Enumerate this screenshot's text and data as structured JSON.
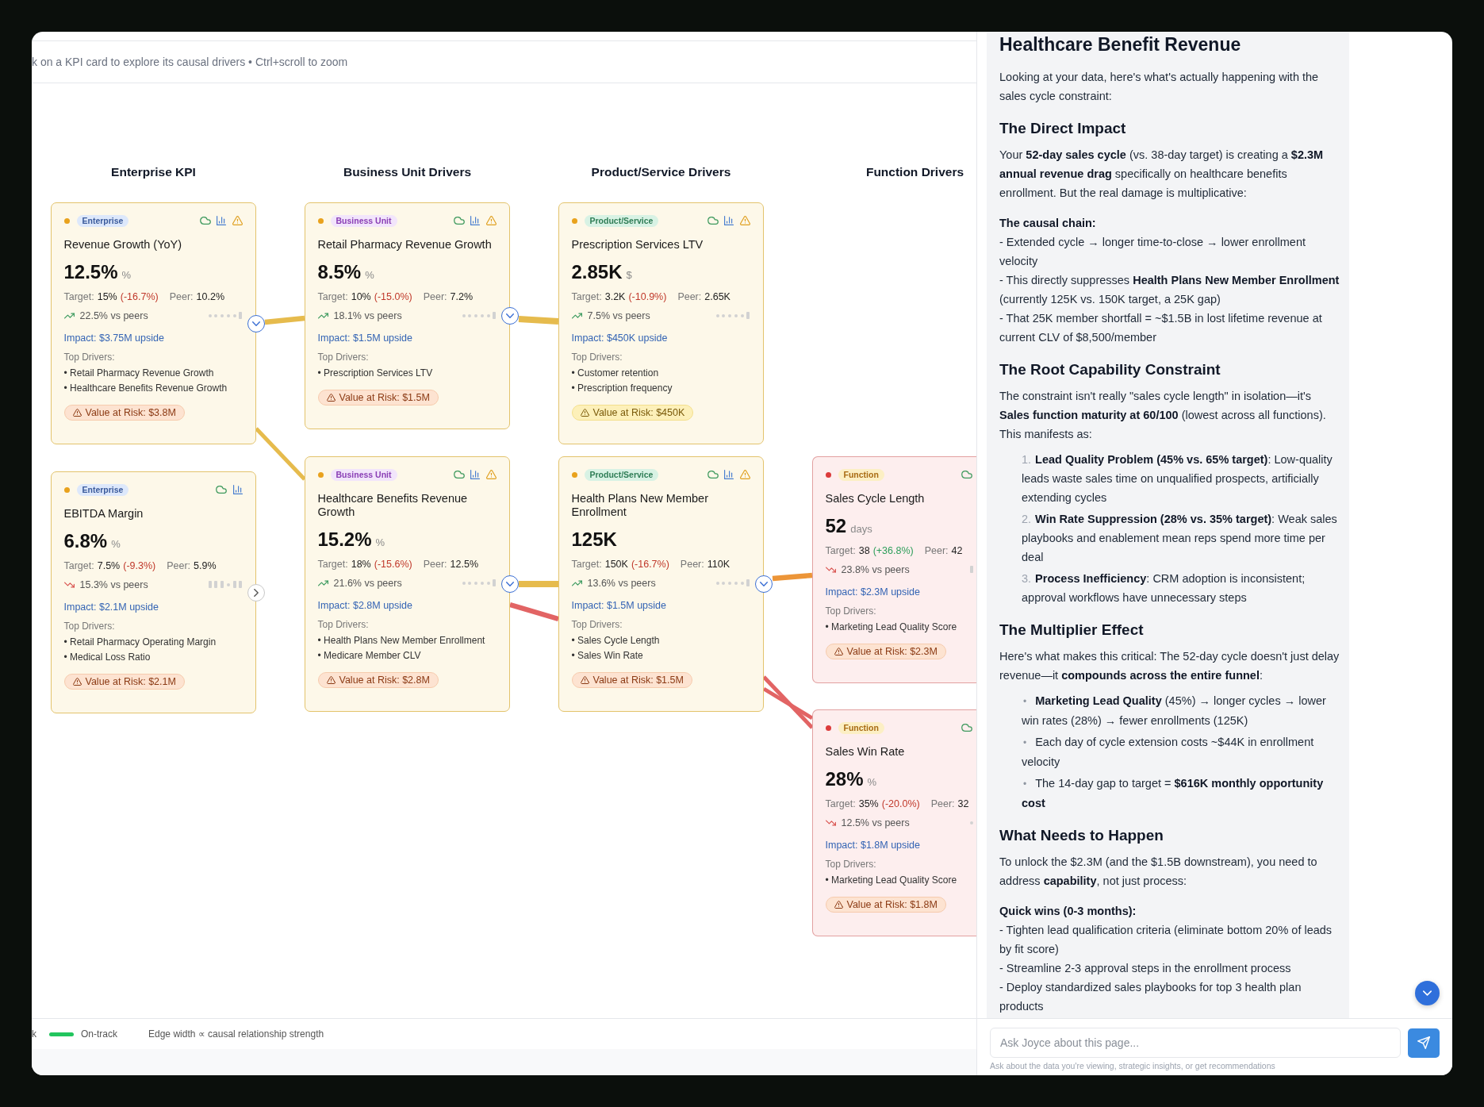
{
  "header": {
    "hint": "k on a KPI card to explore its causal drivers • Ctrl+scroll to zoom"
  },
  "canvas": {
    "columns": [
      {
        "title": "Enterprise KPI",
        "kind": "enterprise",
        "cards": [
          {
            "kind": "warning",
            "tag": "Enterprise",
            "icons": [
              {
                "kind": "cloud"
              },
              {
                "kind": "chart"
              },
              {
                "kind": "warning"
              }
            ],
            "title": "Revenue Growth (YoY)",
            "value": "12.5%",
            "unit": "%",
            "target": {
              "label": "Target:",
              "value": "15%",
              "gap": {
                "text": "(-16.7%)",
                "kind": "below"
              }
            },
            "peer": {
              "label": "Peer:",
              "value": "10.2%"
            },
            "trend": {
              "kind": "up",
              "text": "22.5% vs peers"
            },
            "spark": [
              {
                "kind": "dot"
              },
              {
                "kind": "dot"
              },
              {
                "kind": "dot"
              },
              {
                "kind": "dot"
              },
              {
                "kind": "dot"
              },
              {
                "kind": "bar"
              }
            ],
            "impact": "Impact: $3.75M upside",
            "drivers_label": "Top Drivers:",
            "drivers": [
              "• Retail Pharmacy Revenue Growth",
              "• Healthcare Benefits Revenue Growth"
            ],
            "risk": {
              "text": "Value at Risk: $3.8M",
              "kind": "high"
            },
            "toggle": {
              "expanded": true
            }
          },
          {
            "kind": "warning",
            "tag": "Enterprise",
            "icons": [
              {
                "kind": "cloud"
              },
              {
                "kind": "chart"
              }
            ],
            "title": "EBITDA Margin",
            "value": "6.8%",
            "unit": "%",
            "target": {
              "label": "Target:",
              "value": "7.5%",
              "gap": {
                "text": "(-9.3%)",
                "kind": "below"
              }
            },
            "peer": {
              "label": "Peer:",
              "value": "5.9%"
            },
            "trend": {
              "kind": "down",
              "text": "15.3% vs peers"
            },
            "spark": [
              {
                "kind": "bar"
              },
              {
                "kind": "bar"
              },
              {
                "kind": "bar"
              },
              {
                "kind": "dot"
              },
              {
                "kind": "bar"
              },
              {
                "kind": "bar"
              }
            ],
            "impact": "Impact: $2.1M upside",
            "drivers_label": "Top Drivers:",
            "drivers": [
              "• Retail Pharmacy Operating Margin",
              "• Medical Loss Ratio"
            ],
            "risk": {
              "text": "Value at Risk: $2.1M",
              "kind": "high"
            },
            "toggle": {
              "expanded": false
            }
          }
        ]
      },
      {
        "title": "Business Unit Drivers",
        "kind": "business-unit",
        "cards": [
          {
            "kind": "warning",
            "tag": "Business Unit",
            "icons": [
              {
                "kind": "cloud"
              },
              {
                "kind": "chart"
              },
              {
                "kind": "warning"
              }
            ],
            "title": "Retail Pharmacy Revenue Growth",
            "value": "8.5%",
            "unit": "%",
            "target": {
              "label": "Target:",
              "value": "10%",
              "gap": {
                "text": "(-15.0%)",
                "kind": "below"
              }
            },
            "peer": {
              "label": "Peer:",
              "value": "7.2%"
            },
            "trend": {
              "kind": "up",
              "text": "18.1% vs peers"
            },
            "spark": [
              {
                "kind": "dot"
              },
              {
                "kind": "dot"
              },
              {
                "kind": "dot"
              },
              {
                "kind": "dot"
              },
              {
                "kind": "dot"
              },
              {
                "kind": "bar"
              }
            ],
            "impact": "Impact: $1.5M upside",
            "drivers_label": "Top Drivers:",
            "drivers": [
              "• Prescription Services LTV"
            ],
            "risk": {
              "text": "Value at Risk: $1.5M",
              "kind": "high"
            },
            "toggle": {
              "expanded": true
            }
          },
          {
            "kind": "warning",
            "tag": "Business Unit",
            "icons": [
              {
                "kind": "cloud"
              },
              {
                "kind": "chart"
              },
              {
                "kind": "warning"
              }
            ],
            "title": "Healthcare Benefits Revenue Growth",
            "value": "15.2%",
            "unit": "%",
            "target": {
              "label": "Target:",
              "value": "18%",
              "gap": {
                "text": "(-15.6%)",
                "kind": "below"
              }
            },
            "peer": {
              "label": "Peer:",
              "value": "12.5%"
            },
            "trend": {
              "kind": "up",
              "text": "21.6% vs peers"
            },
            "spark": [
              {
                "kind": "dot"
              },
              {
                "kind": "dot"
              },
              {
                "kind": "dot"
              },
              {
                "kind": "dot"
              },
              {
                "kind": "dot"
              },
              {
                "kind": "bar"
              }
            ],
            "impact": "Impact: $2.8M upside",
            "drivers_label": "Top Drivers:",
            "drivers": [
              "• Health Plans New Member Enrollment",
              "• Medicare Member CLV"
            ],
            "risk": {
              "text": "Value at Risk: $2.8M",
              "kind": "high"
            },
            "toggle": {
              "expanded": true
            }
          }
        ]
      },
      {
        "title": "Product/Service Drivers",
        "kind": "product",
        "cards": [
          {
            "kind": "warning",
            "tag": "Product/Service",
            "icons": [
              {
                "kind": "cloud"
              },
              {
                "kind": "chart"
              },
              {
                "kind": "warning"
              }
            ],
            "title": "Prescription Services LTV",
            "value": "2.85K",
            "unit": "$",
            "target": {
              "label": "Target:",
              "value": "3.2K",
              "gap": {
                "text": "(-10.9%)",
                "kind": "below"
              }
            },
            "peer": {
              "label": "Peer:",
              "value": "2.65K"
            },
            "trend": {
              "kind": "up",
              "text": "7.5% vs peers"
            },
            "spark": [
              {
                "kind": "dot"
              },
              {
                "kind": "dot"
              },
              {
                "kind": "dot"
              },
              {
                "kind": "dot"
              },
              {
                "kind": "dot"
              },
              {
                "kind": "bar"
              }
            ],
            "impact": "Impact: $450K upside",
            "drivers_label": "Top Drivers:",
            "drivers": [
              "• Customer retention",
              "• Prescription frequency"
            ],
            "risk": {
              "text": "Value at Risk: $450K",
              "kind": "medium"
            }
          },
          {
            "kind": "warning",
            "tag": "Product/Service",
            "icons": [
              {
                "kind": "cloud"
              },
              {
                "kind": "chart"
              },
              {
                "kind": "warning"
              }
            ],
            "title": "Health Plans New Member Enrollment",
            "value": "125K",
            "target": {
              "label": "Target:",
              "value": "150K",
              "gap": {
                "text": "(-16.7%)",
                "kind": "below"
              }
            },
            "peer": {
              "label": "Peer:",
              "value": "110K"
            },
            "trend": {
              "kind": "up",
              "text": "13.6% vs peers"
            },
            "spark": [
              {
                "kind": "dot"
              },
              {
                "kind": "dot"
              },
              {
                "kind": "dot"
              },
              {
                "kind": "dot"
              },
              {
                "kind": "dot"
              },
              {
                "kind": "bar"
              }
            ],
            "impact": "Impact: $1.5M upside",
            "drivers_label": "Top Drivers:",
            "drivers": [
              "• Sales Cycle Length",
              "• Sales Win Rate"
            ],
            "risk": {
              "text": "Value at Risk: $1.5M",
              "kind": "high"
            },
            "toggle": {
              "expanded": true
            }
          }
        ]
      },
      {
        "title": "Function Drivers",
        "kind": "function",
        "cards": [
          {
            "kind": "critical",
            "tag": "Function",
            "icons": [
              {
                "kind": "cloud"
              }
            ],
            "title": "Sales Cycle Length",
            "value": "52",
            "unit": "days",
            "target": {
              "label": "Target:",
              "value": "38",
              "gap": {
                "text": "(+36.8%)",
                "kind": "above"
              }
            },
            "peer": {
              "label": "Peer:",
              "value": "42"
            },
            "trend": {
              "kind": "down",
              "text": "23.8% vs peers"
            },
            "spark": [
              {
                "kind": "bar"
              }
            ],
            "impact": "Impact: $2.3M upside",
            "drivers_label": "Top Drivers:",
            "drivers": [
              "• Marketing Lead Quality Score"
            ],
            "risk": {
              "text": "Value at Risk: $2.3M",
              "kind": "high"
            }
          },
          {
            "kind": "critical",
            "tag": "Function",
            "icons": [
              {
                "kind": "cloud"
              }
            ],
            "title": "Sales Win Rate",
            "value": "28%",
            "unit": "%",
            "target": {
              "label": "Target:",
              "value": "35%",
              "gap": {
                "text": "(-20.0%)",
                "kind": "below"
              }
            },
            "peer": {
              "label": "Peer:",
              "value": "32"
            },
            "trend": {
              "kind": "down",
              "text": "12.5% vs peers"
            },
            "spark": [
              {
                "kind": "dot"
              }
            ],
            "impact": "Impact: $1.8M upside",
            "drivers_label": "Top Drivers:",
            "drivers": [
              "• Marketing Lead Quality Score"
            ],
            "risk": {
              "text": "Value at Risk: $1.8M",
              "kind": "high"
            }
          }
        ]
      }
    ],
    "edges": [
      {
        "kind": "medium",
        "color": "#e6bb4d"
      },
      {
        "kind": "light",
        "color": "#e6bb4d"
      },
      {
        "kind": "strong",
        "color": "#e6bb4d"
      },
      {
        "kind": "strong",
        "color": "#e6bb4d"
      },
      {
        "kind": "medium",
        "color": "#e26464"
      },
      {
        "kind": "medium",
        "color": "#ec9538"
      },
      {
        "kind": "light",
        "color": "#e26464"
      },
      {
        "kind": "light",
        "color": "#e26464"
      }
    ]
  },
  "legend": {
    "items": [
      {
        "label": "k"
      },
      {
        "label": "On-track",
        "color": "#22c55e"
      }
    ],
    "note": "Edge width ∝ causal relationship strength"
  },
  "panel": {
    "title": "Healthcare Benefit Revenue",
    "blocks": [
      {
        "kind": "p",
        "text": "Looking at your data, here's what's actually happening with the sales cycle constraint:"
      },
      {
        "kind": "h",
        "text": "The Direct Impact"
      },
      {
        "kind": "p",
        "text": "Your **52-day sales cycle** (vs. 38-day target) is creating a **$2.3M annual revenue drag** specifically on healthcare benefits enrollment. But the real damage is multiplicative:"
      },
      {
        "kind": "lines",
        "heading": "The causal chain:",
        "lines": [
          "- Extended cycle → longer time-to-close → lower enrollment velocity",
          "- This directly suppresses **Health Plans New Member Enrollment** (currently 125K vs. 150K target, a 25K gap)",
          "- That 25K member shortfall = ~$1.5B in lost lifetime revenue at current CLV of $8,500/member"
        ]
      },
      {
        "kind": "h",
        "text": "The Root Capability Constraint"
      },
      {
        "kind": "p",
        "text": "The constraint isn't really \"sales cycle length\" in isolation—it's **Sales function maturity at 60/100** (lowest across all functions). This manifests as:"
      },
      {
        "kind": "ol",
        "items": [
          {
            "marker": "1.",
            "text": "**Lead Quality Problem (45% vs. 65% target)**: Low-quality leads waste sales time on unqualified prospects, artificially extending cycles"
          },
          {
            "marker": "2.",
            "text": "**Win Rate Suppression (28% vs. 35% target)**: Weak sales playbooks and enablement mean reps spend more time per deal"
          },
          {
            "marker": "3.",
            "text": "**Process Inefficiency**: CRM adoption is inconsistent; approval workflows have unnecessary steps"
          }
        ]
      },
      {
        "kind": "h",
        "text": "The Multiplier Effect"
      },
      {
        "kind": "p",
        "text": "Here's what makes this critical: The 52-day cycle doesn't just delay revenue—it **compounds across the entire funnel**:"
      },
      {
        "kind": "ul",
        "items": [
          {
            "marker": "•",
            "text": "**Marketing Lead Quality** (45%) → longer cycles → lower win rates (28%) → fewer enrollments (125K)"
          },
          {
            "marker": "•",
            "text": "Each day of cycle extension costs ~$44K in enrollment velocity"
          },
          {
            "marker": "•",
            "text": "The 14-day gap to target = **$616K monthly opportunity cost**"
          }
        ]
      },
      {
        "kind": "h",
        "text": "What Needs to Happen"
      },
      {
        "kind": "p",
        "text": "To unlock the $2.3M (and the $1.5B downstream), you need to address **capability**, not just process:"
      },
      {
        "kind": "lines",
        "heading": "Quick wins (0-3 months):",
        "lines": [
          "- Tighten lead qualification criteria (eliminate bottom 20% of leads by fit score)",
          "- Streamline 2-3 approval steps in the enrollment process",
          "- Deploy standardized sales playbooks for top 3 health plan products"
        ]
      }
    ],
    "input": {
      "placeholder": "Ask Joyce about this page..."
    },
    "hint": "Ask about the data you're viewing, strategic insights, or get recommendations"
  }
}
